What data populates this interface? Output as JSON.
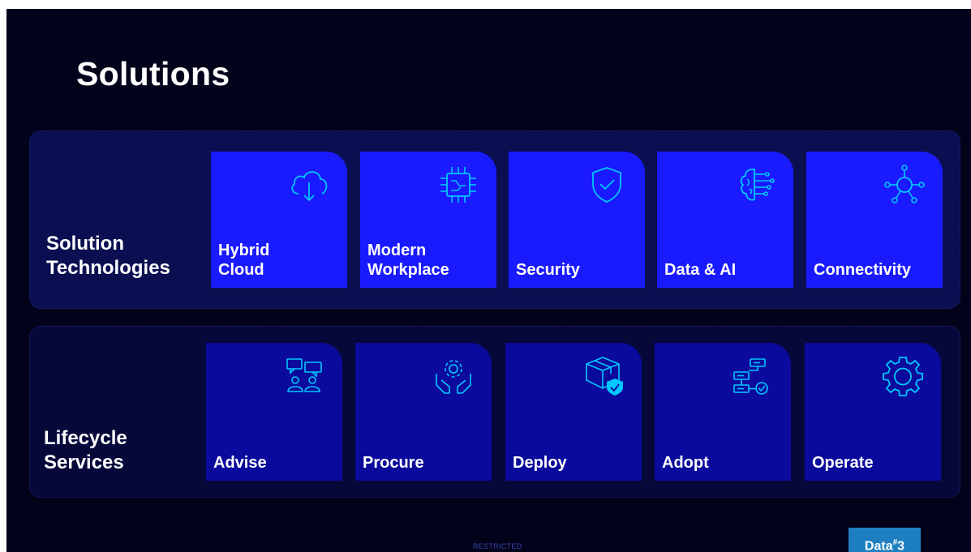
{
  "title": "Solutions",
  "bands": {
    "tech": {
      "label_line1": "Solution",
      "label_line2": "Technologies"
    },
    "life": {
      "label_line1": "Lifecycle",
      "label_line2": "Services"
    }
  },
  "tech_tiles": [
    {
      "line1": "Hybrid",
      "line2": "Cloud",
      "icon": "cloud-download-icon"
    },
    {
      "line1": "Modern",
      "line2": "Workplace",
      "icon": "circuit-chip-icon"
    },
    {
      "line1": "",
      "line2": "Security",
      "icon": "shield-check-icon"
    },
    {
      "line1": "",
      "line2": "Data & AI",
      "icon": "ai-brain-icon"
    },
    {
      "line1": "",
      "line2": "Connectivity",
      "icon": "network-nodes-icon"
    }
  ],
  "life_tiles": [
    {
      "label": "Advise",
      "icon": "people-chat-icon"
    },
    {
      "label": "Procure",
      "icon": "hands-gear-icon"
    },
    {
      "label": "Deploy",
      "icon": "box-shield-icon"
    },
    {
      "label": "Adopt",
      "icon": "workflow-check-icon"
    },
    {
      "label": "Operate",
      "icon": "gear-icon"
    }
  ],
  "footer": {
    "classification": "RESTRICTED"
  },
  "logo": {
    "text": "Data",
    "sup": "#",
    "suffix": "3"
  },
  "colors": {
    "background": "#02021a",
    "tile_bright": "#1a1aff",
    "tile_dark": "#0a0a9c",
    "icon": "#00c8ff",
    "logo": "#1e7fc0"
  }
}
